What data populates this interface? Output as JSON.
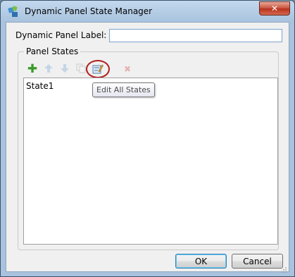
{
  "window": {
    "title": "Dynamic Panel State Manager",
    "close_glyph": "✕"
  },
  "form": {
    "label_text": "Dynamic Panel Label:",
    "label_value": ""
  },
  "panel_states": {
    "group_title": "Panel States",
    "toolbar": {
      "add_icon": "plus-icon",
      "up_icon": "arrow-up-icon",
      "down_icon": "arrow-down-icon",
      "duplicate_icon": "duplicate-icon",
      "edit_icon": "edit-all-states-icon",
      "delete_icon": "delete-icon"
    },
    "states": [
      "State1"
    ],
    "tooltip": "Edit All States"
  },
  "buttons": {
    "ok": "OK",
    "cancel": "Cancel"
  },
  "colors": {
    "highlight_ring": "#b21d1d",
    "add_green": "#3a9a2a"
  }
}
